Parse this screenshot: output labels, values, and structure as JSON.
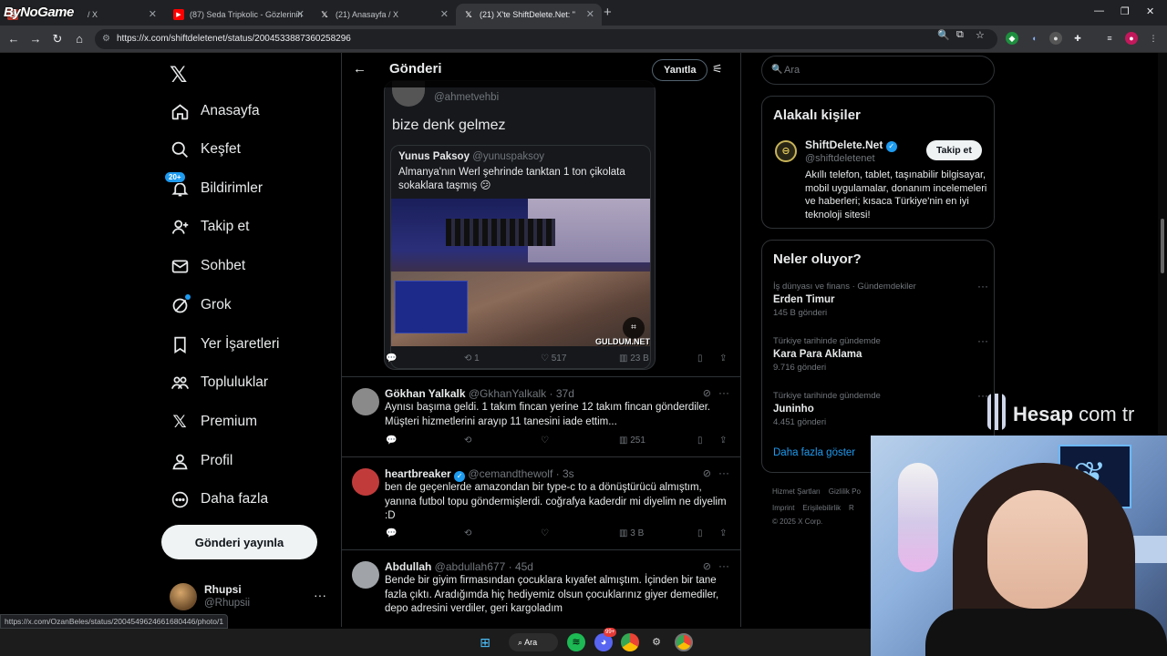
{
  "watermark": "ByNoGame",
  "tabs": [
    {
      "title": "/ X",
      "icon": "logo-icon",
      "active": false
    },
    {
      "title": "(87) Seda Tripkolic - Gözlerinin",
      "icon": "youtube-icon",
      "active": false
    },
    {
      "title": "(21) Anasayfa / X",
      "icon": "x-icon",
      "active": false
    },
    {
      "title": "(21) X'te ShiftDelete.Net: \"",
      "icon": "x-icon",
      "active": true
    }
  ],
  "address": {
    "url": "https://x.com/shiftdeletenet/status/2004533887360258296"
  },
  "nav": {
    "items": [
      {
        "label": "Anasayfa",
        "icon": "home-icon"
      },
      {
        "label": "Keşfet",
        "icon": "search-icon"
      },
      {
        "label": "Bildirimler",
        "icon": "bell-icon",
        "badge": "20+"
      },
      {
        "label": "Takip et",
        "icon": "add-user-icon"
      },
      {
        "label": "Sohbet",
        "icon": "mail-icon"
      },
      {
        "label": "Grok",
        "icon": "grok-icon"
      },
      {
        "label": "Yer İşaretleri",
        "icon": "bookmark-icon"
      },
      {
        "label": "Topluluklar",
        "icon": "communities-icon"
      },
      {
        "label": "Premium",
        "icon": "x-icon"
      },
      {
        "label": "Profil",
        "icon": "profile-icon"
      },
      {
        "label": "Daha fazla",
        "icon": "more-circle-icon"
      }
    ],
    "post_button": "Gönderi yayınla",
    "account": {
      "name": "Rhupsi",
      "handle": "@Rhupsii"
    }
  },
  "header": {
    "title": "Gönderi",
    "reply_button": "Yanıtla"
  },
  "main_post": {
    "quote_handle": "@ahmetvehbi",
    "quote_text": "bize denk gelmez",
    "inner": {
      "name": "Yunus Paksoy",
      "handle": "@yunuspaksoy",
      "text": "Almanya'nın Werl şehrinde tanktan 1 ton çikolata sokaklara taşmış 😕",
      "image_watermark": "GULDUM.NET"
    },
    "stats": {
      "retweets": "1",
      "likes": "517",
      "views": "23 B"
    }
  },
  "replies": [
    {
      "name": "Gökhan Yalkalk",
      "handle": "@GkhanYalkalk",
      "time": "37d",
      "verified": false,
      "text": "Aynısı başıma geldi. 1 takım fincan yerine 12 takım fincan gönderdiler. Müşteri hizmetlerini arayıp 11 tanesini iade ettim...",
      "views": "251",
      "avatar_color": "#8a8a8a"
    },
    {
      "name": "heartbreaker",
      "handle": "@cemandthewolf",
      "time": "3s",
      "verified": true,
      "text": "ben de geçenlerde amazondan bir type-c to a dönüştürücü almıştım, yanına futbol topu göndermişlerdi. coğrafya kaderdir mi diyelim ne diyelim :D",
      "views": "3 B",
      "avatar_color": "#c23b3b"
    },
    {
      "name": "Abdullah",
      "handle": "@abdullah677",
      "time": "45d",
      "verified": false,
      "text": "Bende bir giyim firmasından çocuklara kıyafet almıştım. İçinden bir tane fazla çıktı. Aradığımda hiç hediyemiz olsun çocuklarınız giyer demediler, depo adresini verdiler, geri kargoladım",
      "views": "",
      "avatar_color": "#a0a4a8"
    }
  ],
  "right": {
    "search_placeholder": "Ara",
    "related": {
      "title": "Alakalı kişiler",
      "name": "ShiftDelete.Net",
      "handle": "@shiftdeletenet",
      "follow": "Takip et",
      "bio": "Akıllı telefon, tablet, taşınabilir bilgisayar, mobil uygulamalar, donanım incelemeleri ve haberleri; kısaca Türkiye'nin en iyi teknoloji sitesi!"
    },
    "trends": {
      "title": "Neler oluyor?",
      "items": [
        {
          "context": "İş dünyası ve finans · Gündemdekiler",
          "name": "Erden Timur",
          "count": "145 B gönderi"
        },
        {
          "context": "Türkiye tarihinde gündemde",
          "name": "Kara Para Aklama",
          "count": "9.716 gönderi"
        },
        {
          "context": "Türkiye tarihinde gündemde",
          "name": "Juninho",
          "count": "4.451 gönderi"
        }
      ],
      "show_more": "Daha fazla göster"
    },
    "footer": {
      "line1": [
        "Hizmet Şartları",
        "Gizlilik Po"
      ],
      "line2": [
        "Imprint",
        "Erişilebilirlik",
        "R"
      ],
      "copyright": "© 2025 X Corp."
    }
  },
  "overlay_brand": {
    "word1": "Hesap",
    "word2": "com tr"
  },
  "status_url": "https://x.com/OzanBeles/status/2004549624661680446/photo/1",
  "taskbar": {
    "search_label": "Ara",
    "discord_badge": "99+"
  },
  "colors": {
    "accent": "#1d9bf0",
    "background": "#000000",
    "border": "#2f3336",
    "muted": "#71767b"
  }
}
